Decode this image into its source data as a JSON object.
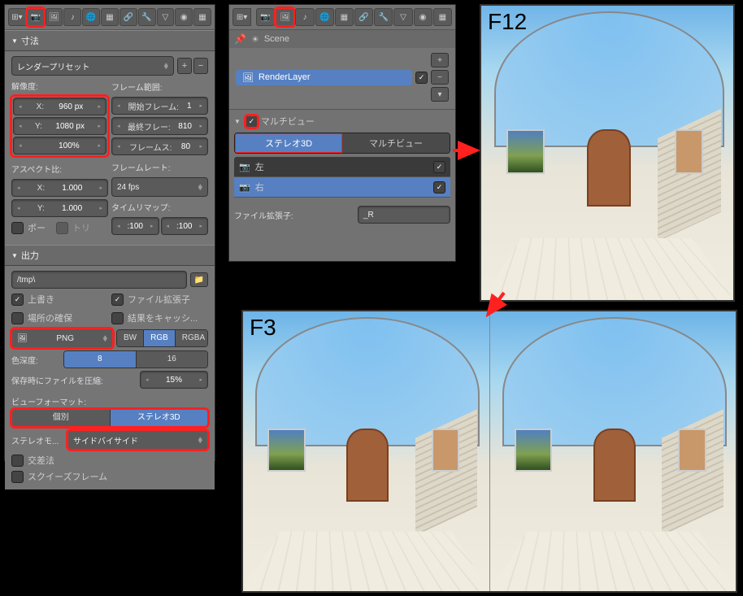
{
  "panel1": {
    "dimensions_header": "寸法",
    "preset": "レンダープリセット",
    "resolution_label": "解像度:",
    "res_x_label": "X:",
    "res_x": "960 px",
    "res_y_label": "Y:",
    "res_y": "1080 px",
    "res_pct": "100%",
    "frame_range_label": "フレーム範囲:",
    "start_label": "開始フレーム:",
    "start_val": "1",
    "end_label": "最終フレー:",
    "end_val": "810",
    "step_label": "フレームス:",
    "step_val": "80",
    "aspect_label": "アスペクト比:",
    "aspect_x_label": "X:",
    "aspect_x": "1.000",
    "aspect_y_label": "Y:",
    "aspect_y": "1.000",
    "border_label": "ボー",
    "tri_label": "トリ",
    "framerate_label": "フレームレート:",
    "framerate": "24 fps",
    "timeremap_label": "タイムリマップ:",
    "tr_a": ":100",
    "tr_b": ":100",
    "output_header": "出力",
    "output_path": "/tmp\\",
    "overwrite": "上書き",
    "ext": "ファイル拡張子",
    "placeholder": "場所の確保",
    "cache": "結果をキャッシ...",
    "format": "PNG",
    "bw": "BW",
    "rgb": "RGB",
    "rgba": "RGBA",
    "depth_label": "色深度:",
    "d8": "8",
    "d16": "16",
    "compress_label": "保存時にファイルを圧縮:",
    "compress_val": "15%",
    "viewformat_label": "ビューフォーマット:",
    "individual": "個別",
    "stereo3d": "ステレオ3D",
    "stereo_mode_label": "ステレオモ...",
    "stereo_mode": "サイドバイサイド",
    "cross": "交差法",
    "squeeze": "スクイーズフレーム"
  },
  "panel2": {
    "scene": "Scene",
    "layer": "RenderLayer",
    "multiview": "マルチビュー",
    "stereo3d": "ステレオ3D",
    "multiview_tab": "マルチビュー",
    "left": "左",
    "right": "右",
    "file_suffix_label": "ファイル拡張子:",
    "file_suffix": "_R"
  },
  "labels": {
    "f12": "F12",
    "f3": "F3"
  }
}
